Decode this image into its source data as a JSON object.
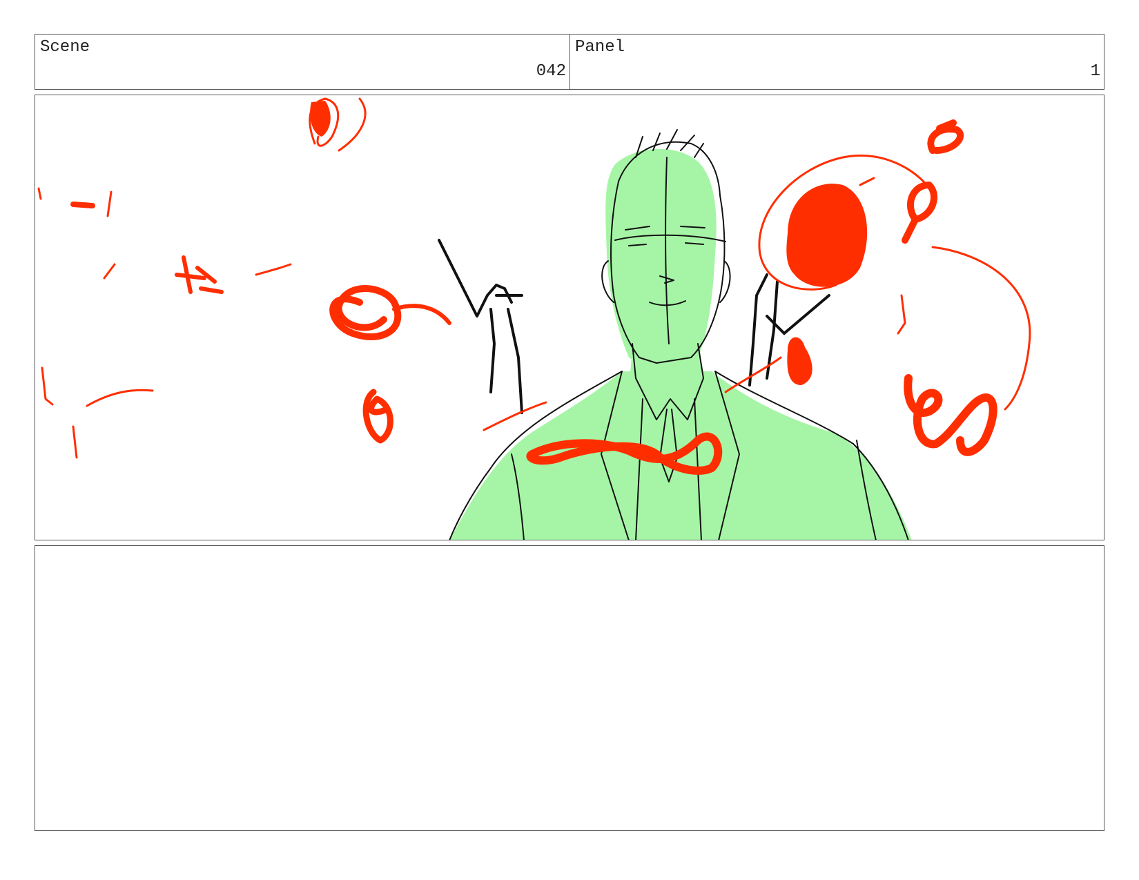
{
  "header": {
    "scene": {
      "label": "Scene",
      "value": "042"
    },
    "panel": {
      "label": "Panel",
      "value": "1"
    }
  },
  "colors": {
    "border": "#555555",
    "sketch_red": "#ff2e00",
    "sketch_green": "#a6f5a6",
    "sketch_line": "#111111"
  },
  "frame": {
    "content": "sketch"
  },
  "notes": {
    "text": ""
  }
}
